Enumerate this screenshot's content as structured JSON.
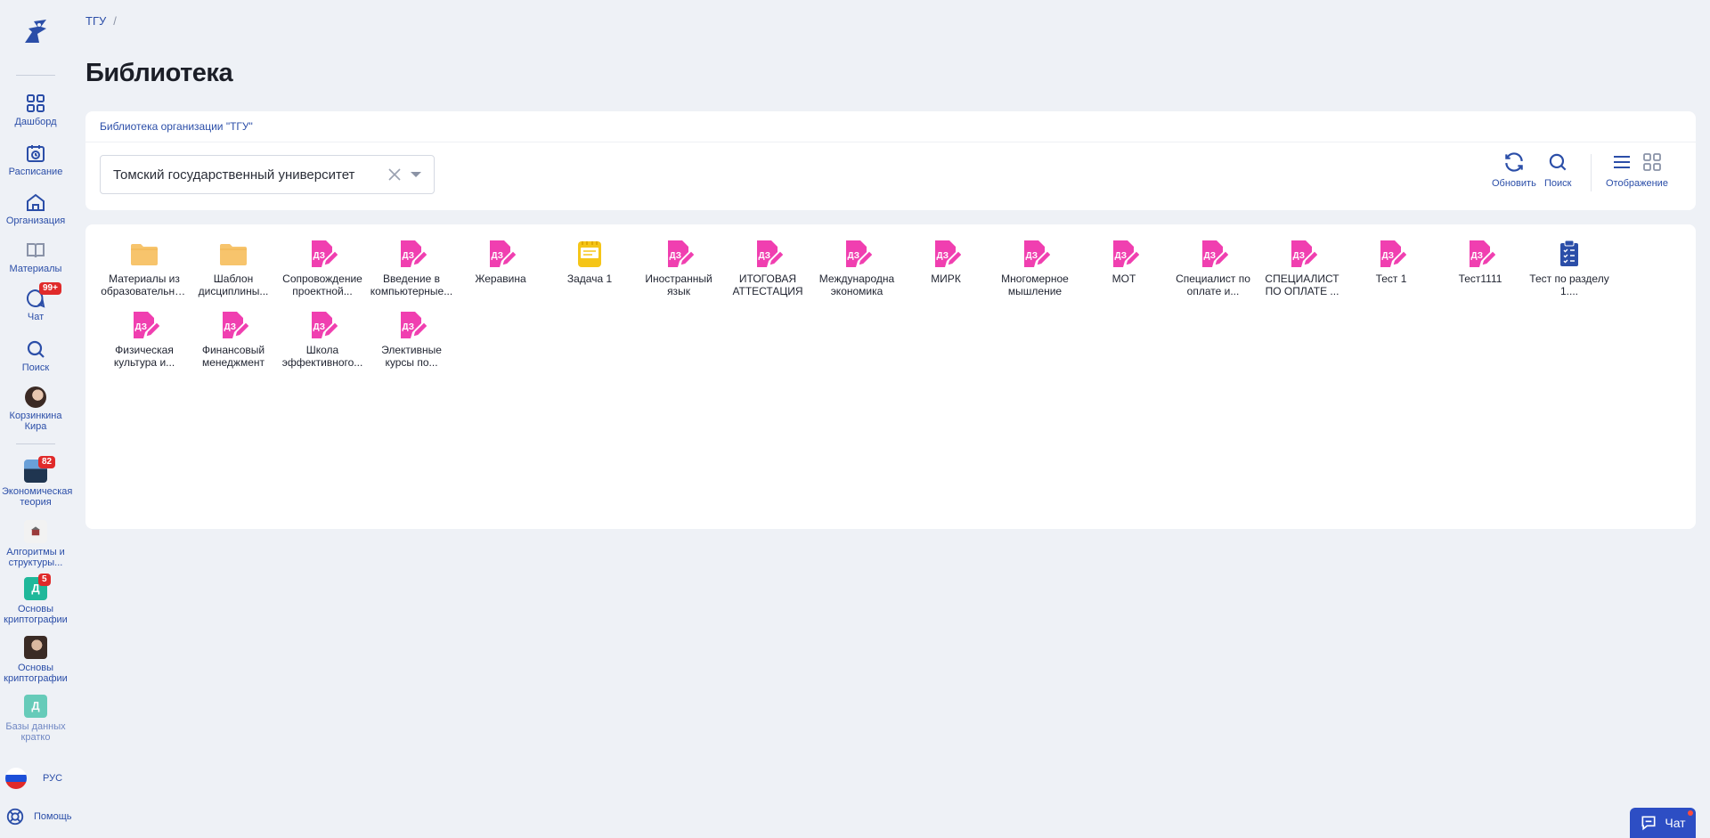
{
  "sidebar": {
    "nav": [
      {
        "label": "Дашборд",
        "icon": "dashboard-icon"
      },
      {
        "label": "Расписание",
        "icon": "calendar-icon"
      },
      {
        "label": "Организация",
        "icon": "organization-icon"
      },
      {
        "label": "Материалы",
        "icon": "book-icon"
      },
      {
        "label": "Чат",
        "icon": "chat-icon",
        "badge": "99+"
      },
      {
        "label": "Поиск",
        "icon": "search-icon"
      },
      {
        "label": "Корзинкина Кира",
        "icon": "avatar"
      }
    ],
    "courses": [
      {
        "label": "Экономическая теория",
        "badge": "82"
      },
      {
        "label": "Алгоритмы и структуры..."
      },
      {
        "label": "Основы криптографии",
        "letter": "Д",
        "badge": "5"
      },
      {
        "label": "Основы криптографии"
      },
      {
        "label": "Базы данных кратко",
        "letter": "Д"
      }
    ],
    "lang": "РУС",
    "help": "Помощь"
  },
  "breadcrumb": {
    "org": "ТГУ",
    "sep": "/"
  },
  "page_title": "Библиотека",
  "library": {
    "org_link": "Библиотека организации \"ТГУ\"",
    "select_value": "Томский государственный университет",
    "tools": {
      "refresh": "Обновить",
      "search": "Поиск",
      "display": "Отображение"
    }
  },
  "items": [
    {
      "name": "Материалы из образовательных программ",
      "type": "folder"
    },
    {
      "name": "Шаблон дисциплины...",
      "type": "folder"
    },
    {
      "name": "Сопровождение проектной...",
      "type": "homework"
    },
    {
      "name": "Введение в компьютерные...",
      "type": "homework"
    },
    {
      "name": "Жеравина",
      "type": "homework"
    },
    {
      "name": "Задача 1",
      "type": "task"
    },
    {
      "name": "Иностранный язык",
      "type": "homework"
    },
    {
      "name": "ИТОГОВАЯ АТТЕСТАЦИЯ",
      "type": "homework"
    },
    {
      "name": "Международна экономика",
      "type": "homework"
    },
    {
      "name": "МИРК",
      "type": "homework"
    },
    {
      "name": "Многомерное мышление",
      "type": "homework"
    },
    {
      "name": "МОТ",
      "type": "homework"
    },
    {
      "name": "Специалист по оплате и...",
      "type": "homework"
    },
    {
      "name": "СПЕЦИАЛИСТ ПО ОПЛАТЕ ...",
      "type": "homework"
    },
    {
      "name": "Тест 1",
      "type": "homework"
    },
    {
      "name": "Тест1111",
      "type": "homework"
    },
    {
      "name": "Тест по разделу 1....",
      "type": "test"
    },
    {
      "name": "Физическая культура и...",
      "type": "homework"
    },
    {
      "name": "Финансовый менеджмент",
      "type": "homework"
    },
    {
      "name": "Школа эффективного...",
      "type": "homework"
    },
    {
      "name": "Элективные курсы по...",
      "type": "homework"
    }
  ],
  "chat_button": "Чат",
  "colors": {
    "accent": "#2b4ea8",
    "homework": "#f03fb0",
    "folder": "#f7c46c",
    "task": "#f5c518",
    "badge": "#e02a2a"
  }
}
